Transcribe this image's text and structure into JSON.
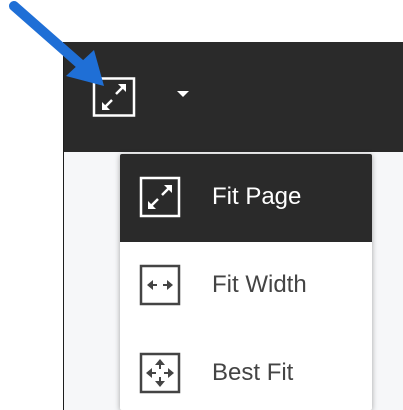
{
  "toolbar": {
    "fit_button_icon": "fit-page-icon",
    "dropdown_icon": "caret-down-icon",
    "background_color": "#2a2a2a"
  },
  "menu": {
    "items": [
      {
        "label": "Fit Page",
        "icon": "fit-page-icon",
        "selected": true
      },
      {
        "label": "Fit Width",
        "icon": "fit-width-icon",
        "selected": false
      },
      {
        "label": "Best Fit",
        "icon": "best-fit-icon",
        "selected": false
      }
    ]
  },
  "annotation": {
    "icon": "pointer-arrow",
    "color": "#1f6fd6"
  }
}
